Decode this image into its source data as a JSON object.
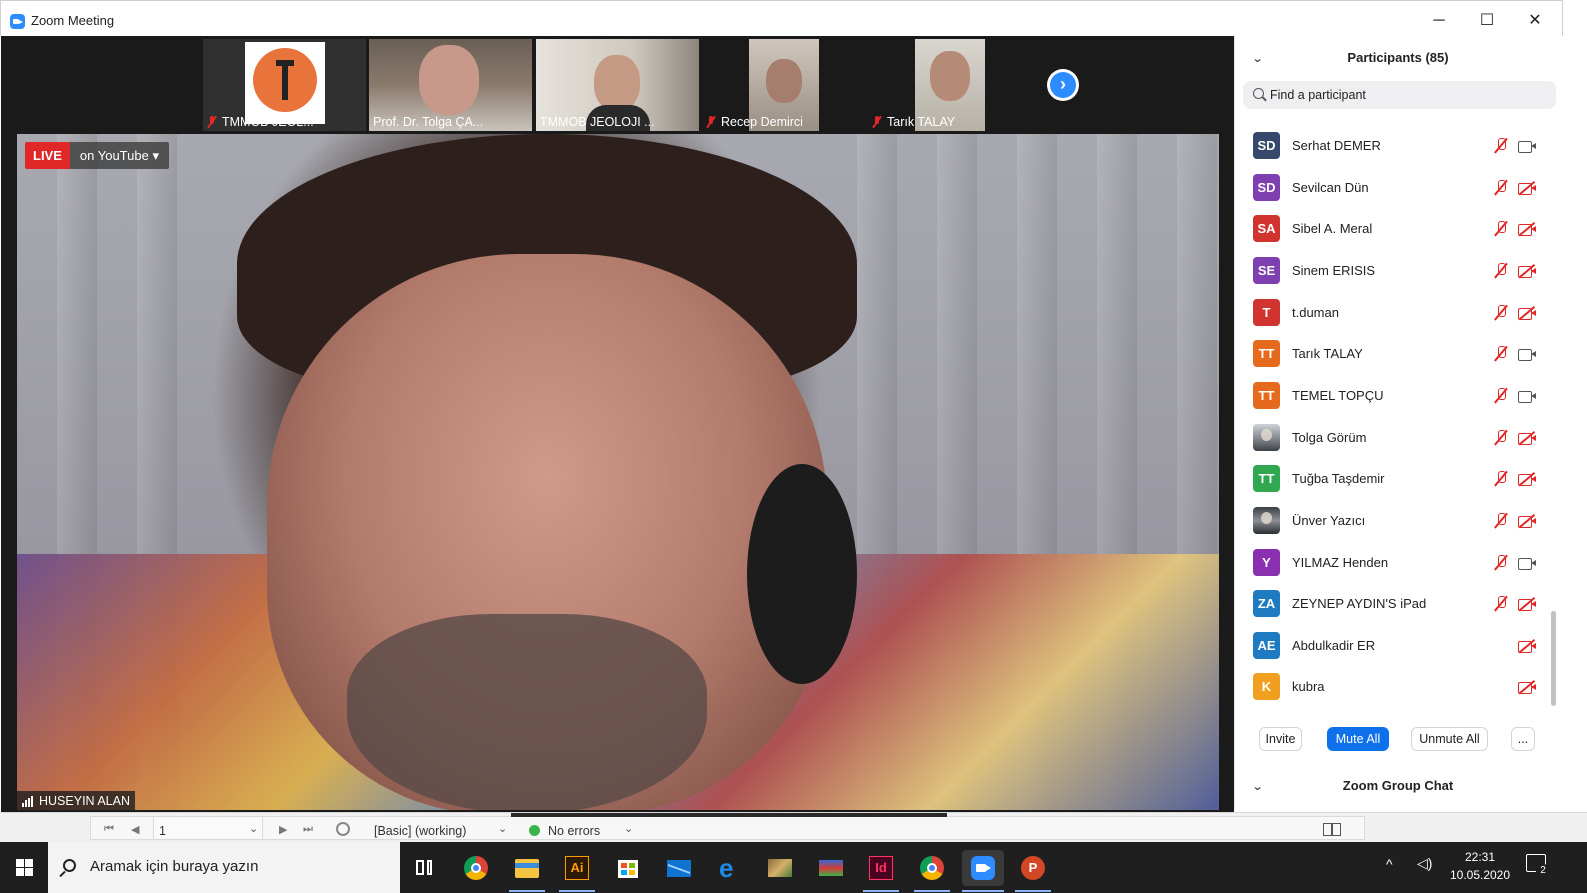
{
  "window": {
    "title": "Zoom Meeting",
    "minimize_label": "─",
    "maximize_label": "☐",
    "close_label": "✕"
  },
  "thumbnails": [
    {
      "name": "TMMOB JEOL...",
      "muted": true
    },
    {
      "name": "Prof. Dr. Tolga ÇA...",
      "muted": false
    },
    {
      "name": "TMMOB JEOLOJI ...",
      "muted": false
    },
    {
      "name": "Recep Demirci",
      "muted": true
    },
    {
      "name": "Tarık TALAY",
      "muted": true
    }
  ],
  "next_arrow": "›",
  "live": {
    "badge": "LIVE",
    "platform": "on YouTube ▾"
  },
  "active_speaker": "HUSEYIN ALAN",
  "participants_panel": {
    "header": "Participants (85)",
    "collapse_glyph": "⌄",
    "search_placeholder": "Find a participant",
    "participants": [
      {
        "initials": "SD",
        "name": "Serhat DEMER",
        "color": "#36486b",
        "mic_muted": true,
        "video_off": false
      },
      {
        "initials": "SD",
        "name": "Sevilcan Dün",
        "color": "#7e3fb0",
        "mic_muted": true,
        "video_off": true
      },
      {
        "initials": "SA",
        "name": "Sibel A. Meral",
        "color": "#d1342f",
        "mic_muted": true,
        "video_off": true
      },
      {
        "initials": "SE",
        "name": "Sinem ERISIS",
        "color": "#7e3fb0",
        "mic_muted": true,
        "video_off": true
      },
      {
        "initials": "T",
        "name": "t.duman",
        "color": "#d1342f",
        "mic_muted": true,
        "video_off": true
      },
      {
        "initials": "TT",
        "name": "Tarık TALAY",
        "color": "#e56a1e",
        "mic_muted": true,
        "video_off": false
      },
      {
        "initials": "TT",
        "name": "TEMEL TOPÇU",
        "color": "#e56a1e",
        "mic_muted": true,
        "video_off": false
      },
      {
        "initials": "",
        "name": "Tolga Görüm",
        "color": "#8a8f96",
        "mic_muted": true,
        "video_off": true,
        "photo": true
      },
      {
        "initials": "TT",
        "name": "Tuğba Taşdemir",
        "color": "#2fa84f",
        "mic_muted": true,
        "video_off": true
      },
      {
        "initials": "",
        "name": "Ünver Yazıcı",
        "color": "#555a60",
        "mic_muted": true,
        "video_off": true,
        "photo": true
      },
      {
        "initials": "Y",
        "name": "YILMAZ Henden",
        "color": "#8a2fb0",
        "mic_muted": true,
        "video_off": false
      },
      {
        "initials": "ZA",
        "name": "ZEYNEP AYDIN'S iPad",
        "color": "#1f7bc1",
        "mic_muted": true,
        "video_off": true
      },
      {
        "initials": "AE",
        "name": "Abdulkadir ER",
        "color": "#1f7bc1",
        "mic_muted": false,
        "video_off": true
      },
      {
        "initials": "K",
        "name": "kubra",
        "color": "#f0a01e",
        "mic_muted": false,
        "video_off": true
      }
    ],
    "buttons": {
      "invite": "Invite",
      "mute_all": "Mute All",
      "unmute_all": "Unmute All",
      "more": "..."
    },
    "chat_header": "Zoom Group Chat"
  },
  "status_bar": {
    "page_value": "1",
    "profile": "[Basic] (working)",
    "errors": "No errors"
  },
  "taskbar": {
    "search_placeholder": "Aramak için buraya yazın",
    "time": "22:31",
    "date": "10.05.2020",
    "notification_count": "2",
    "illustrator_label": "Ai",
    "indesign_label": "Id",
    "powerpoint_label": "P"
  }
}
